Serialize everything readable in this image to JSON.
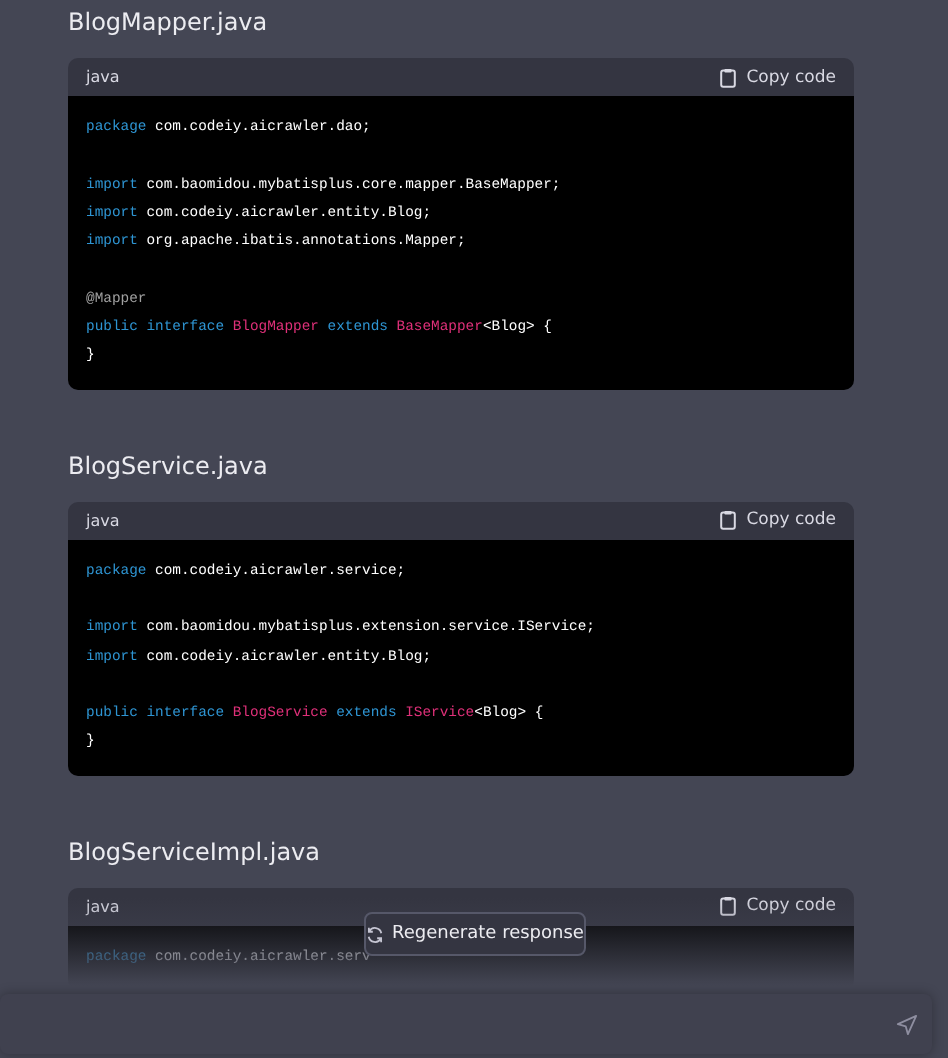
{
  "files": [
    {
      "filename": "BlogMapper.java",
      "language": "java",
      "copy_label": "Copy code",
      "lines": [
        {
          "gap_before": false,
          "tokens": [
            {
              "kind": "keyword",
              "text": "package"
            },
            {
              "kind": "plain",
              "text": " com.codeiy.aicrawler.dao;"
            }
          ]
        },
        {
          "gap_before": true,
          "tokens": [
            {
              "kind": "keyword",
              "text": "import"
            },
            {
              "kind": "plain",
              "text": " com.baomidou.mybatisplus.core.mapper.BaseMapper;"
            }
          ]
        },
        {
          "gap_before": false,
          "tokens": [
            {
              "kind": "keyword",
              "text": "import"
            },
            {
              "kind": "plain",
              "text": " com.codeiy.aicrawler.entity.Blog;"
            }
          ]
        },
        {
          "gap_before": false,
          "tokens": [
            {
              "kind": "keyword",
              "text": "import"
            },
            {
              "kind": "plain",
              "text": " org.apache.ibatis.annotations.Mapper;"
            }
          ]
        },
        {
          "gap_before": true,
          "tokens": [
            {
              "kind": "annotation",
              "text": "@Mapper"
            }
          ]
        },
        {
          "gap_before": false,
          "tokens": [
            {
              "kind": "keyword",
              "text": "public interface "
            },
            {
              "kind": "type",
              "text": "BlogMapper "
            },
            {
              "kind": "keyword",
              "text": "extends "
            },
            {
              "kind": "type",
              "text": "BaseMapper"
            },
            {
              "kind": "plain",
              "text": "<Blog> {"
            }
          ]
        },
        {
          "gap_before": false,
          "tokens": [
            {
              "kind": "plain",
              "text": "}"
            }
          ]
        }
      ]
    },
    {
      "filename": "BlogService.java",
      "language": "java",
      "copy_label": "Copy code",
      "lines": [
        {
          "gap_before": false,
          "tokens": [
            {
              "kind": "keyword",
              "text": "package"
            },
            {
              "kind": "plain",
              "text": " com.codeiy.aicrawler.service;"
            }
          ]
        },
        {
          "gap_before": true,
          "tokens": [
            {
              "kind": "keyword",
              "text": "import"
            },
            {
              "kind": "plain",
              "text": " com.baomidou.mybatisplus.extension.service.IService;"
            }
          ]
        },
        {
          "gap_before": false,
          "tokens": [
            {
              "kind": "keyword",
              "text": "import"
            },
            {
              "kind": "plain",
              "text": " com.codeiy.aicrawler.entity.Blog;"
            }
          ]
        },
        {
          "gap_before": true,
          "tokens": [
            {
              "kind": "keyword",
              "text": "public interface "
            },
            {
              "kind": "type",
              "text": "BlogService "
            },
            {
              "kind": "keyword",
              "text": "extends "
            },
            {
              "kind": "type",
              "text": "IService"
            },
            {
              "kind": "plain",
              "text": "<Blog> {"
            }
          ]
        },
        {
          "gap_before": false,
          "tokens": [
            {
              "kind": "plain",
              "text": "}"
            }
          ]
        }
      ]
    },
    {
      "filename": "BlogServiceImpl.java",
      "language": "java",
      "copy_label": "Copy code",
      "lines": [
        {
          "gap_before": false,
          "tokens": [
            {
              "kind": "keyword",
              "text": "package"
            },
            {
              "kind": "plain",
              "text": " com.codeiy.aicrawler.serv"
            }
          ]
        }
      ]
    }
  ],
  "regenerate_button": {
    "label": "Regenerate response"
  }
}
